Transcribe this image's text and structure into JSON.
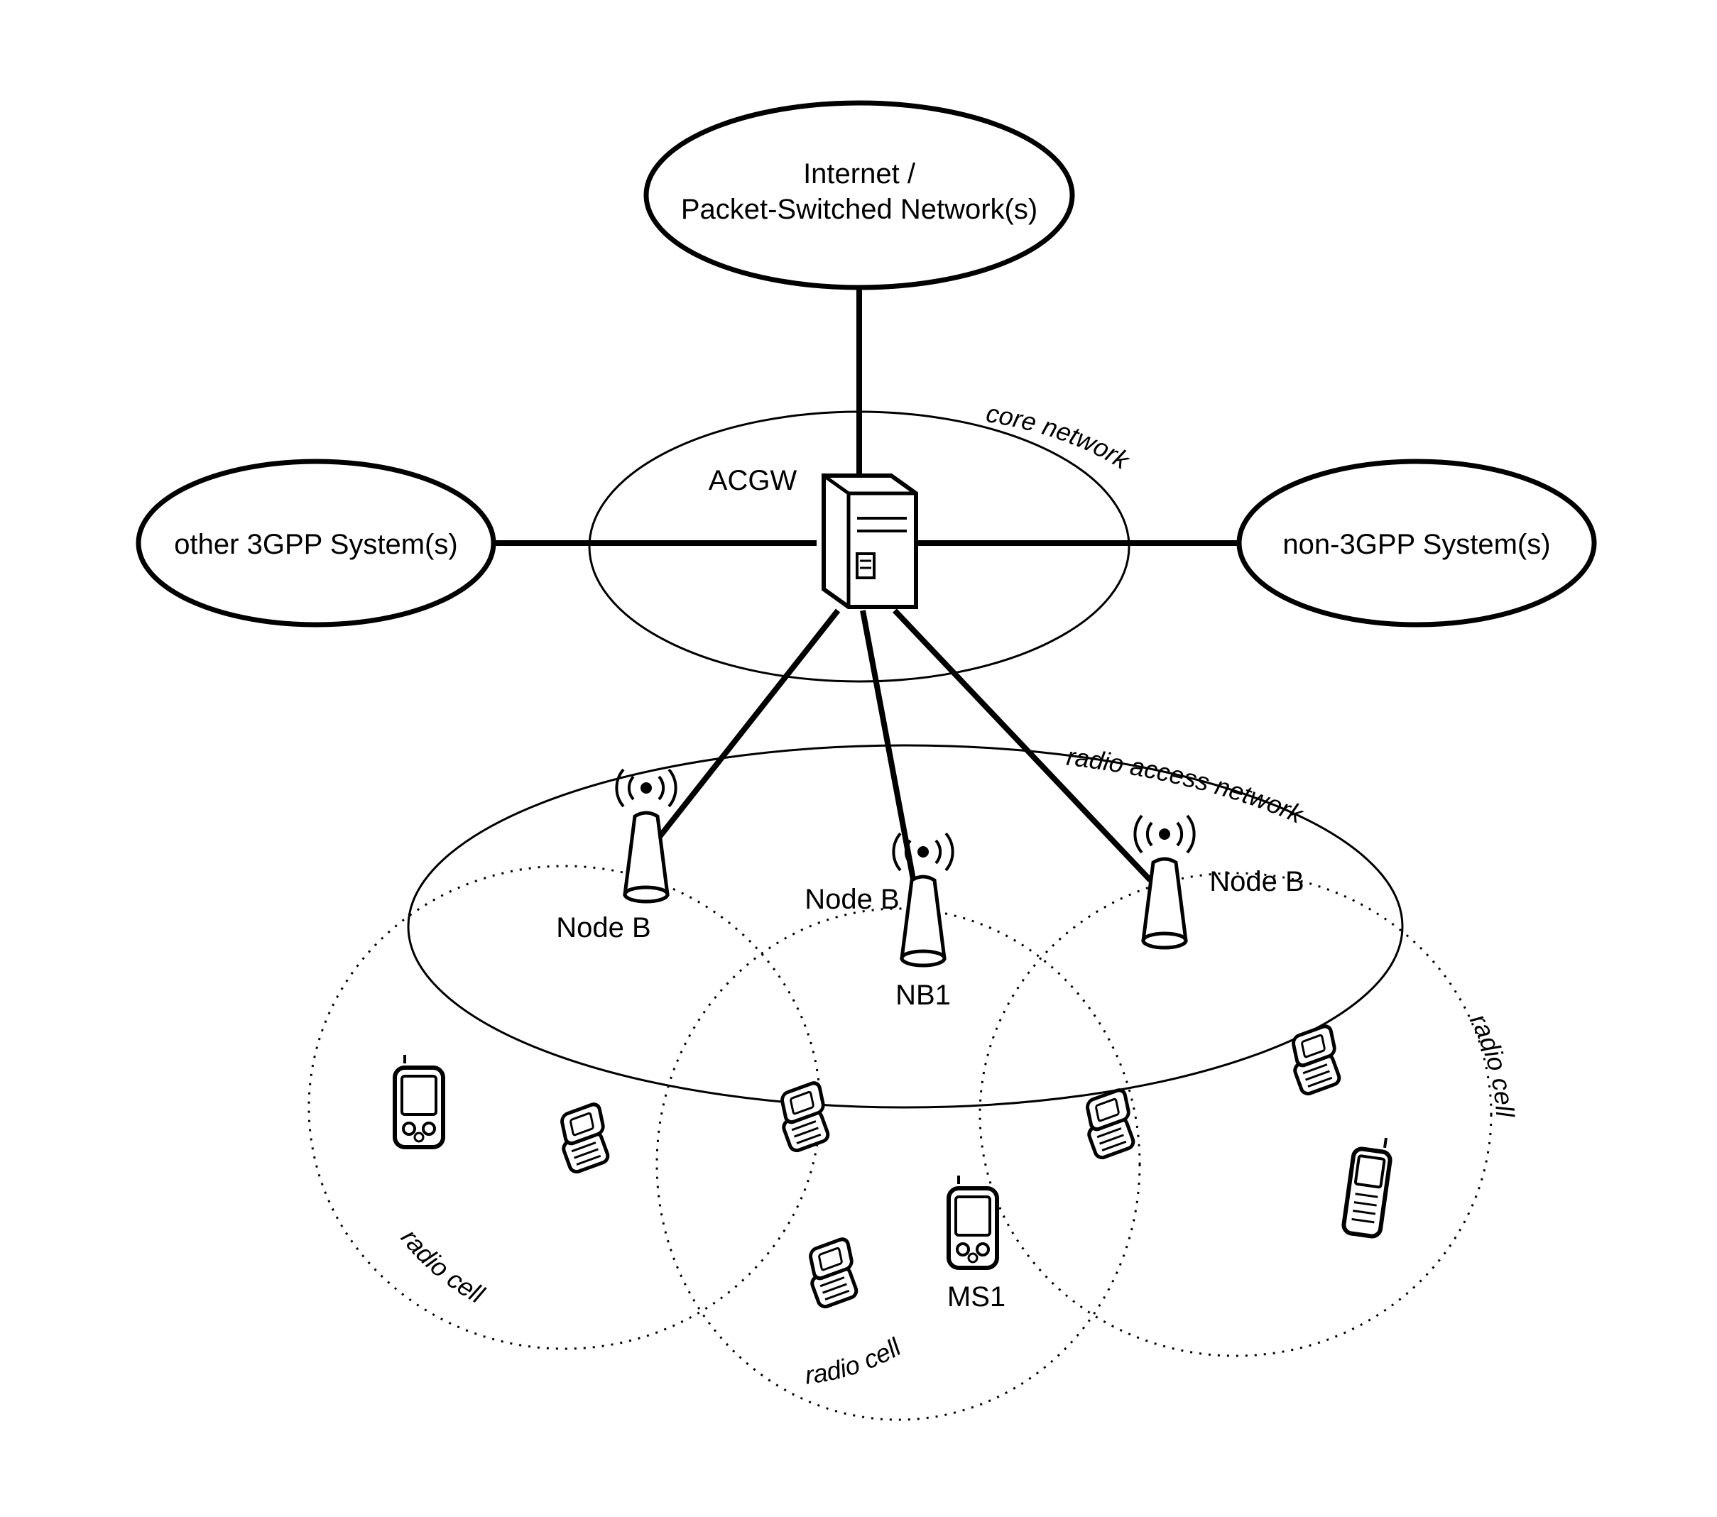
{
  "top_cloud": {
    "line1": "Internet /",
    "line2": "Packet-Switched Network(s)"
  },
  "left_cloud": "other 3GPP System(s)",
  "right_cloud": "non-3GPP System(s)",
  "core_network_label": "core network",
  "acgw_label": "ACGW",
  "ran_label": "radio access network",
  "nodeB_label": "Node B",
  "nb1_label": "NB1",
  "ms1_label": "MS1",
  "radio_cell_label": "radio cell"
}
